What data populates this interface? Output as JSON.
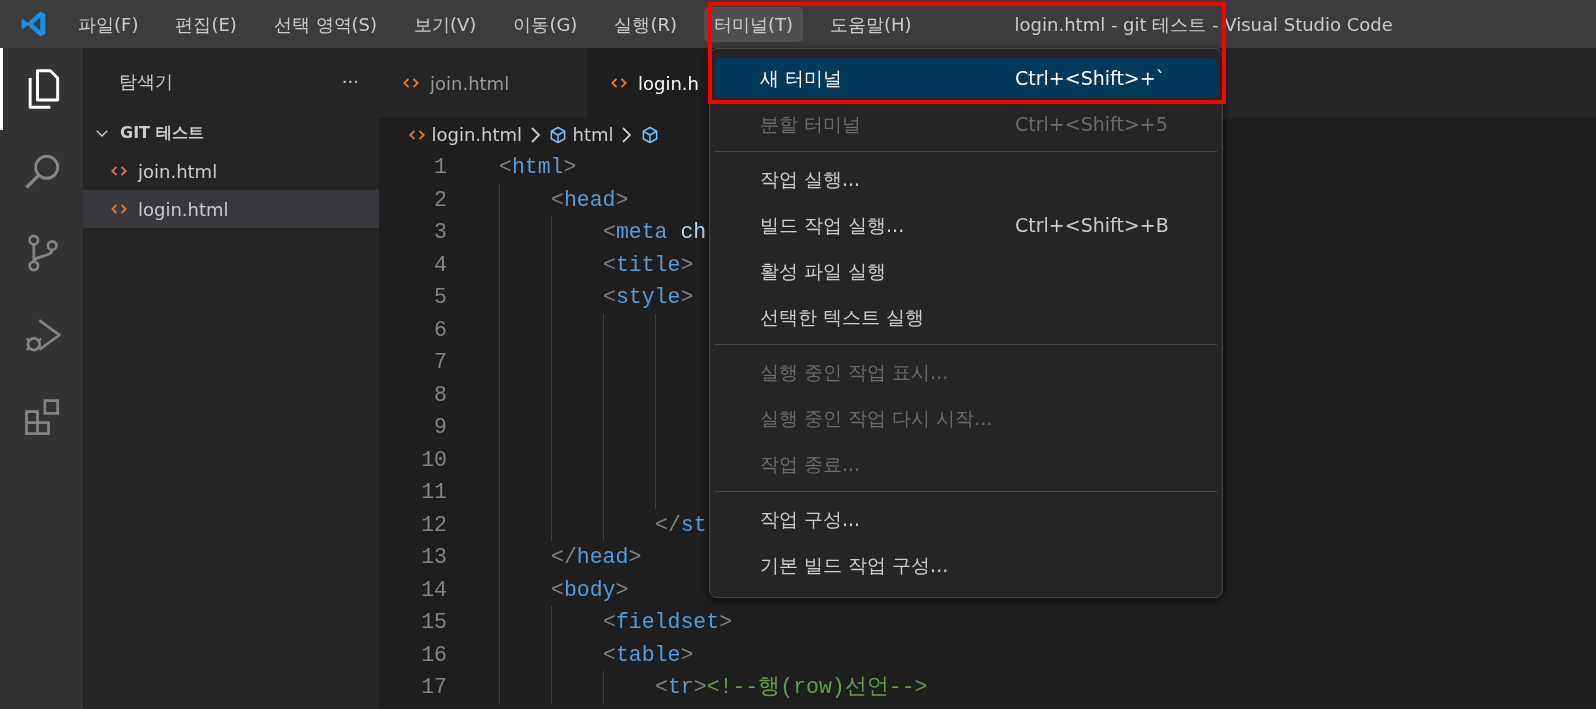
{
  "window": {
    "title": "login.html - git 테스트 - Visual Studio Code"
  },
  "menubar": [
    {
      "label": "파일(F)",
      "selected": false
    },
    {
      "label": "편집(E)",
      "selected": false
    },
    {
      "label": "선택 영역(S)",
      "selected": false
    },
    {
      "label": "보기(V)",
      "selected": false
    },
    {
      "label": "이동(G)",
      "selected": false
    },
    {
      "label": "실행(R)",
      "selected": false
    },
    {
      "label": "터미널(T)",
      "selected": true
    },
    {
      "label": "도움말(H)",
      "selected": false
    }
  ],
  "activity_bar": [
    {
      "kind": "files",
      "selected": true
    },
    {
      "kind": "search",
      "selected": false
    },
    {
      "kind": "source-control",
      "selected": false
    },
    {
      "kind": "run-debug",
      "selected": false
    },
    {
      "kind": "extensions",
      "selected": false
    }
  ],
  "sidebar": {
    "title": "탐색기",
    "more": "···",
    "folder": {
      "label": "GIT 테스트",
      "expanded": true,
      "files": [
        {
          "label": "join.html",
          "selected": false
        },
        {
          "label": "login.html",
          "selected": true
        }
      ]
    }
  },
  "tabs": [
    {
      "label": "join.html",
      "selected": false
    },
    {
      "label": "login.h",
      "selected": true
    }
  ],
  "breadcrumb": [
    {
      "kind": "file",
      "label": "login.html"
    },
    {
      "kind": "element",
      "label": "html"
    },
    {
      "kind": "element"
    }
  ],
  "code": [
    {
      "number": "1",
      "tokens": [
        {
          "kind": "punct",
          "text": "<"
        },
        {
          "kind": "tag",
          "text": "html"
        },
        {
          "kind": "punct",
          "text": ">"
        }
      ]
    },
    {
      "block": [
        {
          "number": "2",
          "tokens": [
            {
              "kind": "punct",
              "text": "<"
            },
            {
              "kind": "tag",
              "text": "head"
            },
            {
              "kind": "punct",
              "text": ">"
            }
          ]
        },
        {
          "block": [
            {
              "number": "3",
              "tokens": [
                {
                  "kind": "punct",
                  "text": "<"
                },
                {
                  "kind": "tag",
                  "text": "meta"
                },
                {
                  "kind": "attr",
                  "text": "ch"
                }
              ]
            },
            {
              "number": "4",
              "tokens": [
                {
                  "kind": "punct",
                  "text": "<"
                },
                {
                  "kind": "tag",
                  "text": "title"
                },
                {
                  "kind": "punct",
                  "text": ">"
                }
              ]
            },
            {
              "number": "5",
              "tokens": [
                {
                  "kind": "punct",
                  "text": "<"
                },
                {
                  "kind": "tag",
                  "text": "style"
                },
                {
                  "kind": "punct",
                  "text": ">"
                }
              ]
            },
            {
              "block": [
                {
                  "block": [
                    {
                      "number": "6"
                    },
                    {
                      "number": "7"
                    },
                    {
                      "number": "8"
                    },
                    {
                      "number": "9"
                    },
                    {
                      "number": "10"
                    },
                    {
                      "number": "11"
                    }
                  ]
                },
                {
                  "number": "12",
                  "tokens": [
                    {
                      "kind": "punct",
                      "text": "</"
                    },
                    {
                      "kind": "tag",
                      "text": "st"
                    }
                  ]
                }
              ]
            }
          ]
        },
        {
          "number": "13",
          "tokens": [
            {
              "kind": "punct",
              "text": "</"
            },
            {
              "kind": "tag",
              "text": "head"
            },
            {
              "kind": "punct",
              "text": ">"
            }
          ]
        },
        {
          "number": "14",
          "tokens": [
            {
              "kind": "punct",
              "text": "<"
            },
            {
              "kind": "tag",
              "text": "body"
            },
            {
              "kind": "punct",
              "text": ">"
            }
          ]
        },
        {
          "block": [
            {
              "number": "15",
              "tokens": [
                {
                  "kind": "punct",
                  "text": "<"
                },
                {
                  "kind": "tag",
                  "text": "fieldset"
                },
                {
                  "kind": "punct",
                  "text": ">"
                }
              ]
            },
            {
              "number": "16",
              "tokens": [
                {
                  "kind": "punct",
                  "text": "<"
                },
                {
                  "kind": "tag",
                  "text": "table"
                },
                {
                  "kind": "punct",
                  "text": ">"
                }
              ]
            },
            {
              "block": [
                {
                  "number": "17",
                  "tokens": [
                    {
                      "kind": "punct",
                      "text": "<"
                    },
                    {
                      "kind": "tag",
                      "text": "tr"
                    },
                    {
                      "kind": "punct",
                      "text": ">"
                    },
                    {
                      "kind": "comment",
                      "text": "<!--행(row)선언-->"
                    }
                  ]
                }
              ]
            }
          ]
        }
      ]
    }
  ],
  "menu": {
    "sections": [
      [
        {
          "label": "새 터미널",
          "shortcut": "Ctrl+<Shift>+`",
          "disabled": false,
          "selected": true
        },
        {
          "label": "분할 터미널",
          "shortcut": "Ctrl+<Shift>+5",
          "disabled": true,
          "selected": false
        }
      ],
      [
        {
          "label": "작업 실행...",
          "disabled": false,
          "selected": false
        },
        {
          "label": "빌드 작업 실행...",
          "shortcut": "Ctrl+<Shift>+B",
          "disabled": false,
          "selected": false
        },
        {
          "label": "활성 파일 실행",
          "disabled": false,
          "selected": false
        },
        {
          "label": "선택한 텍스트 실행",
          "disabled": false,
          "selected": false
        }
      ],
      [
        {
          "label": "실행 중인 작업 표시...",
          "disabled": true,
          "selected": false
        },
        {
          "label": "실행 중인 작업 다시 시작...",
          "disabled": true,
          "selected": false
        },
        {
          "label": "작업 종료...",
          "disabled": true,
          "selected": false
        }
      ],
      [
        {
          "label": "작업 구성...",
          "disabled": false,
          "selected": false
        },
        {
          "label": "기본 빌드 작업 구성...",
          "disabled": false,
          "selected": false
        }
      ]
    ]
  }
}
